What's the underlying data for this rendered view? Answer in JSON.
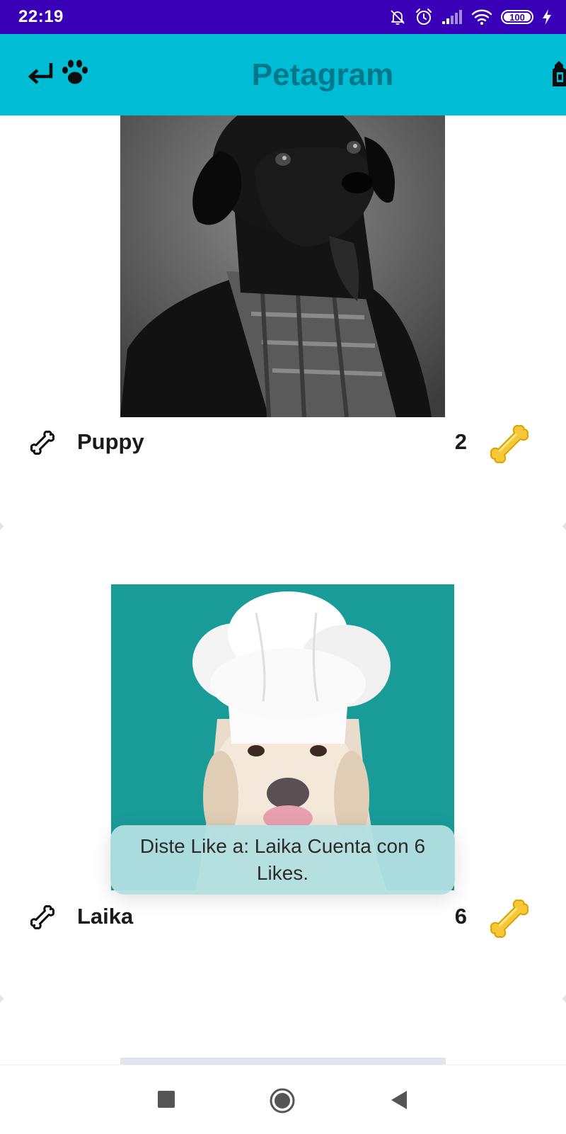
{
  "status_bar": {
    "time": "22:19",
    "battery_level": "100",
    "icons": [
      "mute-bell-icon",
      "alarm-icon",
      "signal-icon",
      "wifi-icon",
      "battery-icon",
      "charging-icon"
    ]
  },
  "app_bar": {
    "title": "Petagram",
    "icons": [
      "back-arrow-icon",
      "paw-icon",
      "stats-icon"
    ]
  },
  "pets": [
    {
      "name": "Puppy",
      "likes": "2",
      "photo": "black dog wearing a plaid bandana"
    },
    {
      "name": "Laika",
      "likes": "6",
      "photo": "white dog wearing a chef hat on teal background"
    }
  ],
  "toast": {
    "message": "Diste Like a: Laika Cuenta con 6 Likes."
  },
  "nav_bar": {
    "buttons": [
      "recents-button",
      "home-button",
      "back-button"
    ]
  },
  "colors": {
    "status_bar": "#3a00b7",
    "app_bar": "#00bcd4",
    "title": "#00788c",
    "like_bone": "#f6c737",
    "toast": "#b2dfe0"
  }
}
